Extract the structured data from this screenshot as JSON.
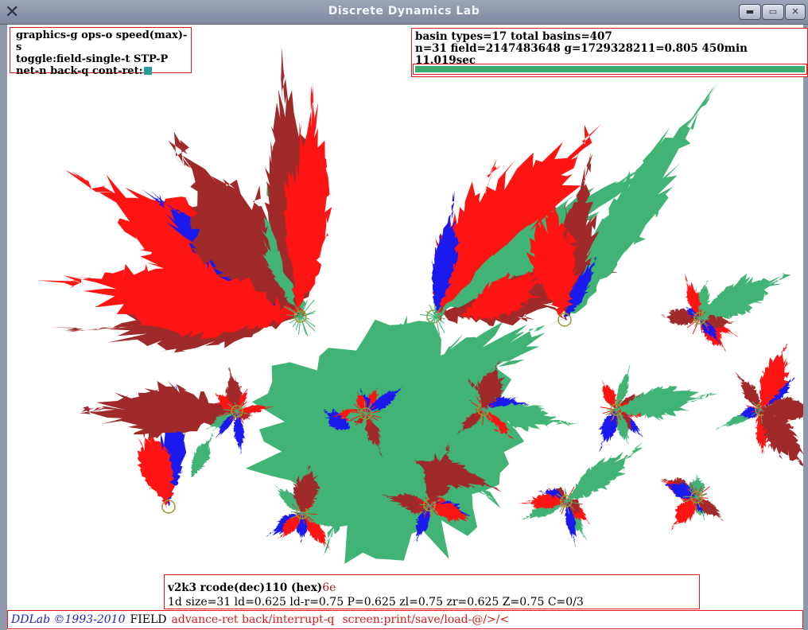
{
  "window": {
    "title": "Discrete Dynamics Lab",
    "app_icon": "x-logo-icon",
    "controls": [
      "minimize-icon",
      "maximize-icon",
      "close-icon"
    ]
  },
  "key_panel": {
    "line1": "graphics-g ops-o speed(max)-s",
    "line2": "toggle:field-single-t STP-P",
    "line3": "net-n back-q cont-ret:"
  },
  "basin_panel": {
    "line1": "basin types=17 total basins=407",
    "line2": "n=31 field=2147483648 g=1729328211=0.805  450min 11.019sec",
    "progress_fraction": 1.0
  },
  "rule_panel": {
    "line1_prefix": "v2k3 rcode(dec)110  (hex)",
    "hex_value": "6e",
    "line2": "1d size=31 ld=0.625 ld-r=0.75 P=0.625 zl=0.75 zr=0.625 Z=0.75 C=0/3"
  },
  "status_bar": {
    "brand": "DDLab ©1993-2010",
    "mode": "FIELD",
    "hint1": "advance-ret back/interrupt-q",
    "hint2": "screen:print/save/load-@/>/<"
  },
  "colors": {
    "red": "#ff1414",
    "dark_red": "#a02a2a",
    "blue": "#1a1aee",
    "green": "#41b374",
    "panel_border": "#e01b1b",
    "attractor": "#9a9a2a"
  }
}
